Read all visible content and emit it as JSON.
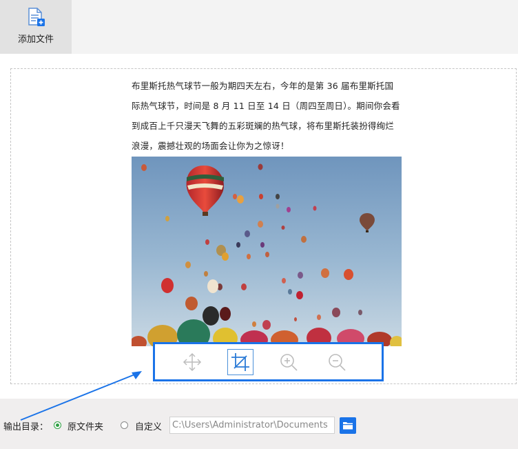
{
  "toolbar": {
    "add_file_label": "添加文件",
    "add_file_icon": "add-document-icon"
  },
  "document": {
    "lines": [
      "布里斯托热气球节一般为期四天左右，今年的是第 36 届布里斯托国",
      "际热气球节，时间是 8 月 11 日至 14 日（周四至周日）。期间你会看",
      "到成百上千只漫天飞舞的五彩斑斓的热气球，将布里斯托装扮得绚烂",
      "浪漫，震撼壮观的场面会让你为之惊讶！"
    ],
    "image": "hot-air-balloons-photo"
  },
  "image_tools": [
    {
      "name": "move-tool",
      "icon": "move-arrows-icon",
      "active": false
    },
    {
      "name": "crop-tool",
      "icon": "crop-icon",
      "active": true
    },
    {
      "name": "zoom-in-tool",
      "icon": "zoom-in-icon",
      "active": false
    },
    {
      "name": "zoom-out-tool",
      "icon": "zoom-out-icon",
      "active": false
    }
  ],
  "output": {
    "label": "输出目录：",
    "options": [
      {
        "label": "原文件夹",
        "checked": true
      },
      {
        "label": "自定义",
        "checked": false
      }
    ],
    "path_value": "C:\\Users\\Administrator\\Documents",
    "folder_icon": "folder-icon"
  },
  "colors": {
    "accent": "#1a73e8",
    "radio_checked": "#2ea043"
  }
}
